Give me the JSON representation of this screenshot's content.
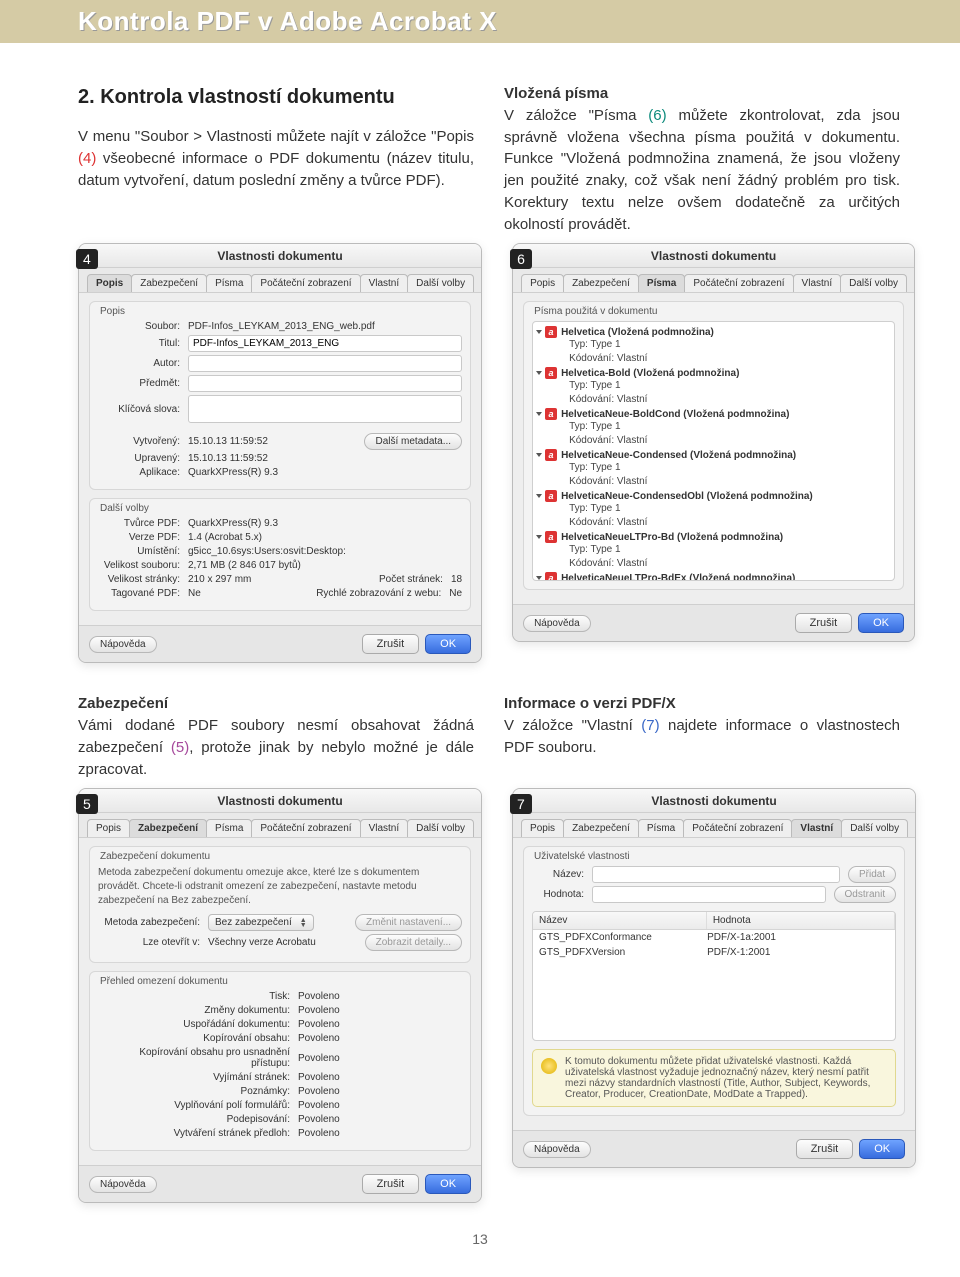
{
  "header": {
    "title": "Kontrola PDF v Adobe Acrobat X"
  },
  "block_a": {
    "heading": "2. Kontrola vlastností dokumentu",
    "p1_a": "V menu \"Soubor > Vlastnosti můžete najít v záložce \"Popis ",
    "p1_num": "(4)",
    "p1_b": " všeobecné informace o PDF dokumentu (název titulu, datum vytvoření, datum poslední změny a tvůrce PDF)."
  },
  "block_b": {
    "heading": "Vložená písma",
    "p1_a": "V záložce \"Písma ",
    "p1_num": "(6)",
    "p1_b": " můžete zkontrolovat, zda jsou správně vložena všechna písma použitá v dokumentu. Funkce \"Vložená podmnožina znamená, že jsou vloženy jen použité znaky, což však není žádný problém pro tisk. Korektury textu nelze ovšem dodatečně za určitých okolností provádět."
  },
  "block_c": {
    "heading": "Zabezpečení",
    "p1_a": "Vámi dodané PDF soubory nesmí obsahovat žádná zabezpečení ",
    "p1_num": "(5)",
    "p1_b": ", protože jinak by nebylo možné je dále zpracovat."
  },
  "block_d": {
    "heading": "Informace o verzi PDF/X",
    "p1_a": "V záložce \"Vlastní ",
    "p1_num": "(7)",
    "p1_b": " najdete informace o vlastnostech PDF souboru."
  },
  "dialog": {
    "title": "Vlastnosti dokumentu",
    "tabs": [
      "Popis",
      "Zabezpečení",
      "Písma",
      "Počáteční zobrazení",
      "Vlastní",
      "Další volby"
    ],
    "btn_help": "Nápověda",
    "btn_cancel": "Zrušit",
    "btn_ok": "OK"
  },
  "dlg4": {
    "badge": "4",
    "active_tab": "Popis",
    "g_desc": "Popis",
    "k_soubor": "Soubor:",
    "v_soubor": "PDF-Infos_LEYKAM_2013_ENG_web.pdf",
    "k_titul": "Titul:",
    "v_titul": "PDF-Infos_LEYKAM_2013_ENG",
    "k_autor": "Autor:",
    "v_autor": "",
    "k_predmet": "Předmět:",
    "v_predmet": "",
    "k_klic": "Klíčová slova:",
    "v_klic": "",
    "k_vytv": "Vytvořený:",
    "v_vytv": "15.10.13 11:59:52",
    "k_upr": "Upravený:",
    "v_upr": "15.10.13 11:59:52",
    "k_apl": "Aplikace:",
    "v_apl": "QuarkXPress(R) 9.3",
    "btn_meta": "Další metadata...",
    "g_more": "Další volby",
    "k_tvurce": "Tvůrce PDF:",
    "v_tvurce": "QuarkXPress(R) 9.3",
    "k_verze": "Verze PDF:",
    "v_verze": "1.4 (Acrobat 5.x)",
    "k_umist": "Umístění:",
    "v_umist": "g5icc_10.6sys:Users:osvit:Desktop:",
    "k_vel": "Velikost souboru:",
    "v_vel": "2,71 MB (2 846 017 bytů)",
    "k_str": "Velikost stránky:",
    "v_str": "210 x 297 mm",
    "k_pocet": "Počet stránek:",
    "v_pocet": "18",
    "k_tag": "Tagované PDF:",
    "v_tag": "Ne",
    "k_rychle": "Rychlé zobrazování z webu:",
    "v_rychle": "Ne"
  },
  "dlg6": {
    "badge": "6",
    "active_tab": "Písma",
    "g_title": "Písma použitá v dokumentu",
    "typ": "Typ: Type 1",
    "kod": "Kódování: Vlastní",
    "fonts": [
      "Helvetica (Vložená podmnožina)",
      "Helvetica-Bold (Vložená podmnožina)",
      "HelveticaNeue-BoldCond (Vložená podmnožina)",
      "HelveticaNeue-Condensed (Vložená podmnožina)",
      "HelveticaNeue-CondensedObl (Vložená podmnožina)",
      "HelveticaNeueLTPro-Bd (Vložená podmnožina)",
      "HelveticaNeueLTPro-BdEx (Vložená podmnožina)"
    ]
  },
  "dlg5": {
    "badge": "5",
    "active_tab": "Zabezpečení",
    "g_sec": "Zabezpečení dokumentu",
    "desc": "Metoda zabezpečení dokumentu omezuje akce, které lze s dokumentem provádět. Chcete-li odstranit omezení ze zabezpečení, nastavte metodu zabezpečení na Bez zabezpečení.",
    "k_method": "Metoda zabezpečení:",
    "v_method": "Bez zabezpečení",
    "btn_change": "Změnit nastavení...",
    "k_open": "Lze otevřít v:",
    "v_open": "Všechny verze Acrobatu",
    "btn_detail": "Zobrazit detaily...",
    "g_restrict": "Přehled omezení dokumentu",
    "allowed": "Povoleno",
    "rows": [
      "Tisk:",
      "Změny dokumentu:",
      "Uspořádání dokumentu:",
      "Kopírování obsahu:",
      "Kopírování obsahu pro usnadnění přístupu:",
      "Vyjímání stránek:",
      "Poznámky:",
      "Vyplňování polí formulářů:",
      "Podepisování:",
      "Vytváření stránek předloh:"
    ]
  },
  "dlg7": {
    "badge": "7",
    "active_tab": "Vlastní",
    "g_user": "Uživatelské vlastnosti",
    "k_name": "Název:",
    "k_value": "Hodnota:",
    "btn_add": "Přidat",
    "btn_del": "Odstranit",
    "th_name": "Název",
    "th_value": "Hodnota",
    "rows": [
      {
        "n": "GTS_PDFXConformance",
        "v": "PDF/X-1a:2001"
      },
      {
        "n": "GTS_PDFXVersion",
        "v": "PDF/X-1:2001"
      }
    ],
    "hint": "K tomuto dokumentu můžete přidat uživatelské vlastnosti. Každá uživatelská vlastnost vyžaduje jednoznačný název, který nesmí patřit mezi názvy standardních vlastností (Title, Author, Subject, Keywords, Creator, Producer, CreationDate, ModDate a Trapped)."
  },
  "pagenum": "13"
}
